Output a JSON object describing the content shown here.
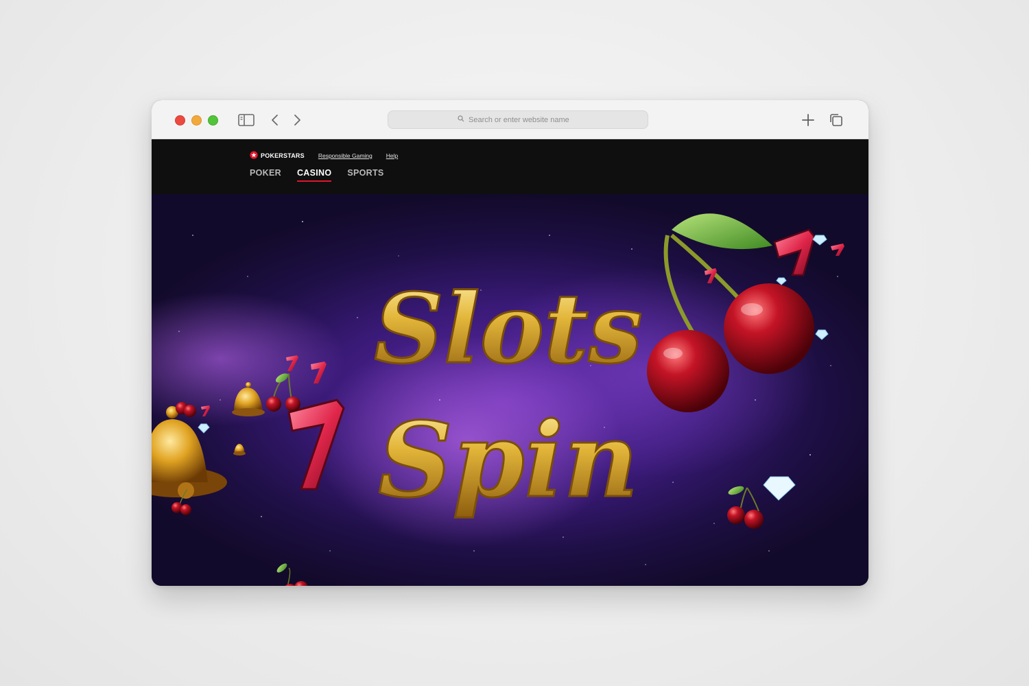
{
  "browser": {
    "search_placeholder": "Search or enter website name",
    "icons": [
      "sidebar-icon",
      "back-icon",
      "forward-icon",
      "search-icon",
      "new-tab-icon",
      "tabs-overview-icon"
    ]
  },
  "site": {
    "brand": "POKERSTARS",
    "brand_color": "#e0162b",
    "toplinks": [
      "Responsible Gaming",
      "Help"
    ],
    "nav": [
      {
        "label": "POKER",
        "active": false
      },
      {
        "label": "CASINO",
        "active": true
      },
      {
        "label": "SPORTS",
        "active": false
      }
    ]
  },
  "hero": {
    "title_line1": "Slots",
    "title_line2": "Spin",
    "title_color": "#d9a92c"
  }
}
